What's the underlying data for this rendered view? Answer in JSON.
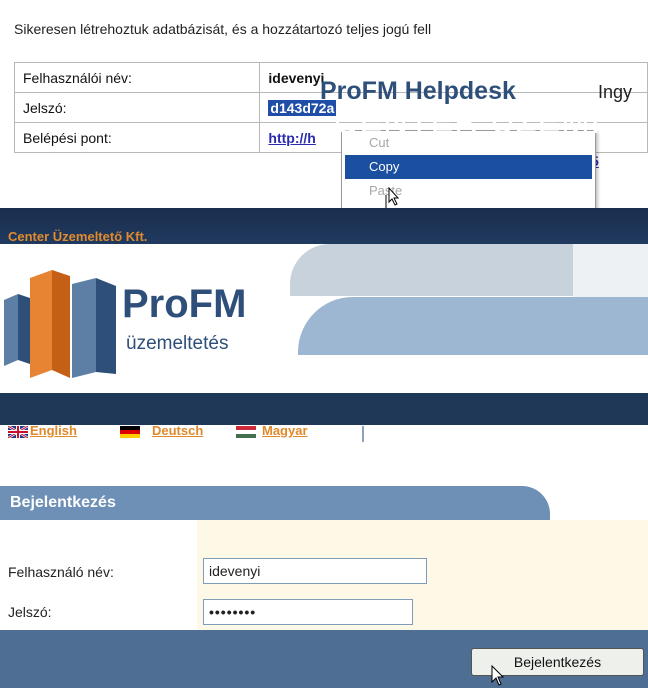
{
  "message": "Sikeresen létrehoztuk adatbázisát, és a hozzátartozó teljes jogú fell",
  "credentials": [
    {
      "label": "Felhasználói név:",
      "value": "idevenyi"
    },
    {
      "label": "Jelszó:",
      "value": "d143d72a"
    },
    {
      "label": "Belépési pont:",
      "value": "http://h",
      "tail": "5"
    }
  ],
  "context_menu": {
    "items": [
      {
        "label": "Cut",
        "state": "disabled"
      },
      {
        "label": "Copy",
        "state": "highlighted"
      },
      {
        "label": "Paste",
        "state": "disabled"
      }
    ]
  },
  "banner": {
    "company": "Center Üzemeltető Kft.",
    "logo_name": "ProFM",
    "logo_subtitle": "üzemeltetés",
    "tab_helpdesk": "ProFM Helpdesk",
    "tab_other": "Ingy",
    "big_title": "CENTER ÜZEMI",
    "languages": [
      "English",
      "Deutsch",
      "Magyar"
    ],
    "colors": {
      "navy": "#203858",
      "orange": "#e0892a",
      "logo_blue": "#2e4f7a"
    }
  },
  "login": {
    "title": "Bejelentkezés",
    "username_label": "Felhasználó név:",
    "username_value": "idevenyi",
    "password_label": "Jelszó:",
    "password_value": "••••••••",
    "submit_label": "Bejelentkezés"
  }
}
